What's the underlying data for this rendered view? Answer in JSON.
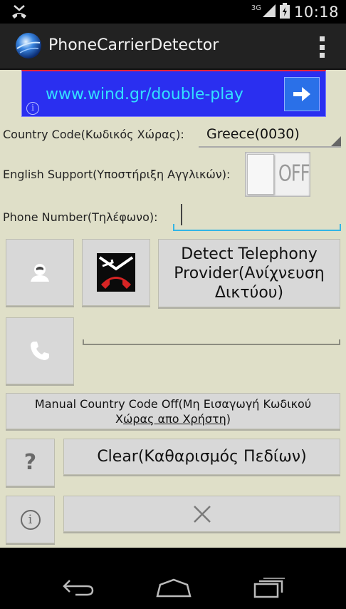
{
  "status_bar": {
    "network_type": "3G",
    "time": "10:18"
  },
  "action_bar": {
    "title": "PhoneCarrierDetector"
  },
  "ad": {
    "url_text": "www.wind.gr/double-play",
    "info_glyph": "i"
  },
  "country": {
    "label": "Country Code(Κωδικός Χώρας):",
    "selected": "Greece(0030)"
  },
  "english_support": {
    "label": "English Support(Υποστήριξη Αγγλικών):",
    "state": "OFF"
  },
  "phone": {
    "label": "Phone Number(Τηλέφωνο):",
    "value": ""
  },
  "buttons": {
    "detect_line1": "Detect Telephony",
    "detect_line2": "Provider(Ανίχνευση",
    "detect_line3": "Δικτύου)",
    "manual_line1": "Manual Country Code Off(Μη Εισαγωγή Κωδικού",
    "manual_line2_a": "Χ",
    "manual_line2_b": "ώρας απο Χρήστη",
    "manual_line2_c": ")",
    "help_glyph": "?",
    "clear": "Clear(Καθαρισμός Πεδίων)",
    "info_glyph": "i"
  },
  "colors": {
    "content_bg": "#dfdfc8",
    "accent_holo_blue": "#33b5e5",
    "ad_bg": "#2a2ff0"
  },
  "icons": {
    "contact": "contact-person-icon",
    "call_reject": "call-reject-icon",
    "phone": "phone-handset-icon",
    "close": "close-x-icon"
  }
}
